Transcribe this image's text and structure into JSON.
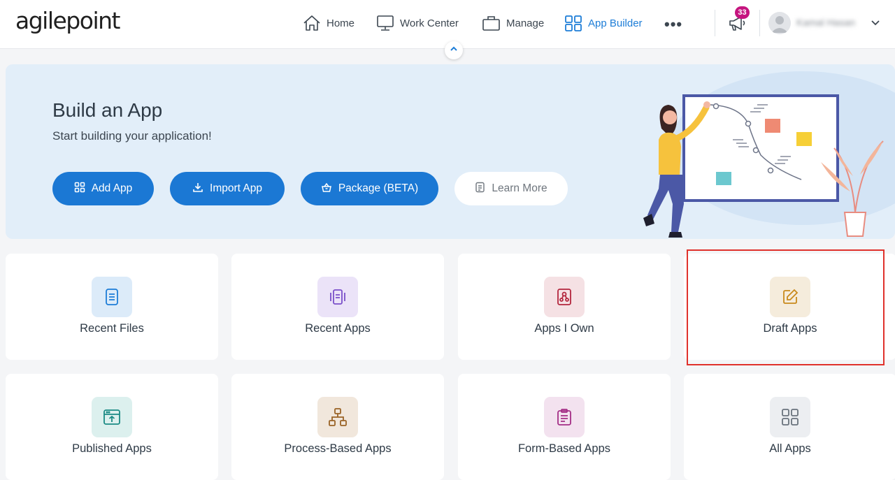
{
  "header": {
    "logo_text": "agilepoint",
    "nav": [
      {
        "label": "Home",
        "icon": "home-icon"
      },
      {
        "label": "Work Center",
        "icon": "monitor-icon"
      },
      {
        "label": "Manage",
        "icon": "briefcase-icon"
      },
      {
        "label": "App Builder",
        "icon": "grid-icon",
        "active": true
      }
    ],
    "more_icon": "more-dots-icon",
    "notification_count": "33",
    "user_name": "Kamal Hasan",
    "accent_color": "#1d7dd7",
    "badge_color": "#c5157f"
  },
  "hero": {
    "title": "Build an App",
    "subtitle": "Start building your application!",
    "buttons": [
      {
        "label": "Add App",
        "icon": "grid-icon"
      },
      {
        "label": "Import App",
        "icon": "download-icon"
      },
      {
        "label": "Package (BETA)",
        "icon": "package-icon"
      },
      {
        "label": "Learn More",
        "icon": "document-icon"
      }
    ],
    "background_color": "#e2eef9",
    "button_color": "#1b78d4"
  },
  "cards": [
    {
      "label": "Recent Files",
      "icon": "recent-files-icon",
      "color": "#1d7dd7"
    },
    {
      "label": "Recent Apps",
      "icon": "recent-apps-icon",
      "color": "#7a4fc9"
    },
    {
      "label": "Apps I Own",
      "icon": "apps-i-own-icon",
      "color": "#b3263d"
    },
    {
      "label": "Draft Apps",
      "icon": "draft-apps-icon",
      "color": "#c98a1c",
      "highlighted": true
    },
    {
      "label": "Published Apps",
      "icon": "published-apps-icon",
      "color": "#1a8a84"
    },
    {
      "label": "Process-Based Apps",
      "icon": "process-based-apps-icon",
      "color": "#9a6326"
    },
    {
      "label": "Form-Based Apps",
      "icon": "form-based-apps-icon",
      "color": "#a42e86"
    },
    {
      "label": "All Apps",
      "icon": "all-apps-icon",
      "color": "#6a737d"
    }
  ],
  "highlight_color": "#e0322c"
}
